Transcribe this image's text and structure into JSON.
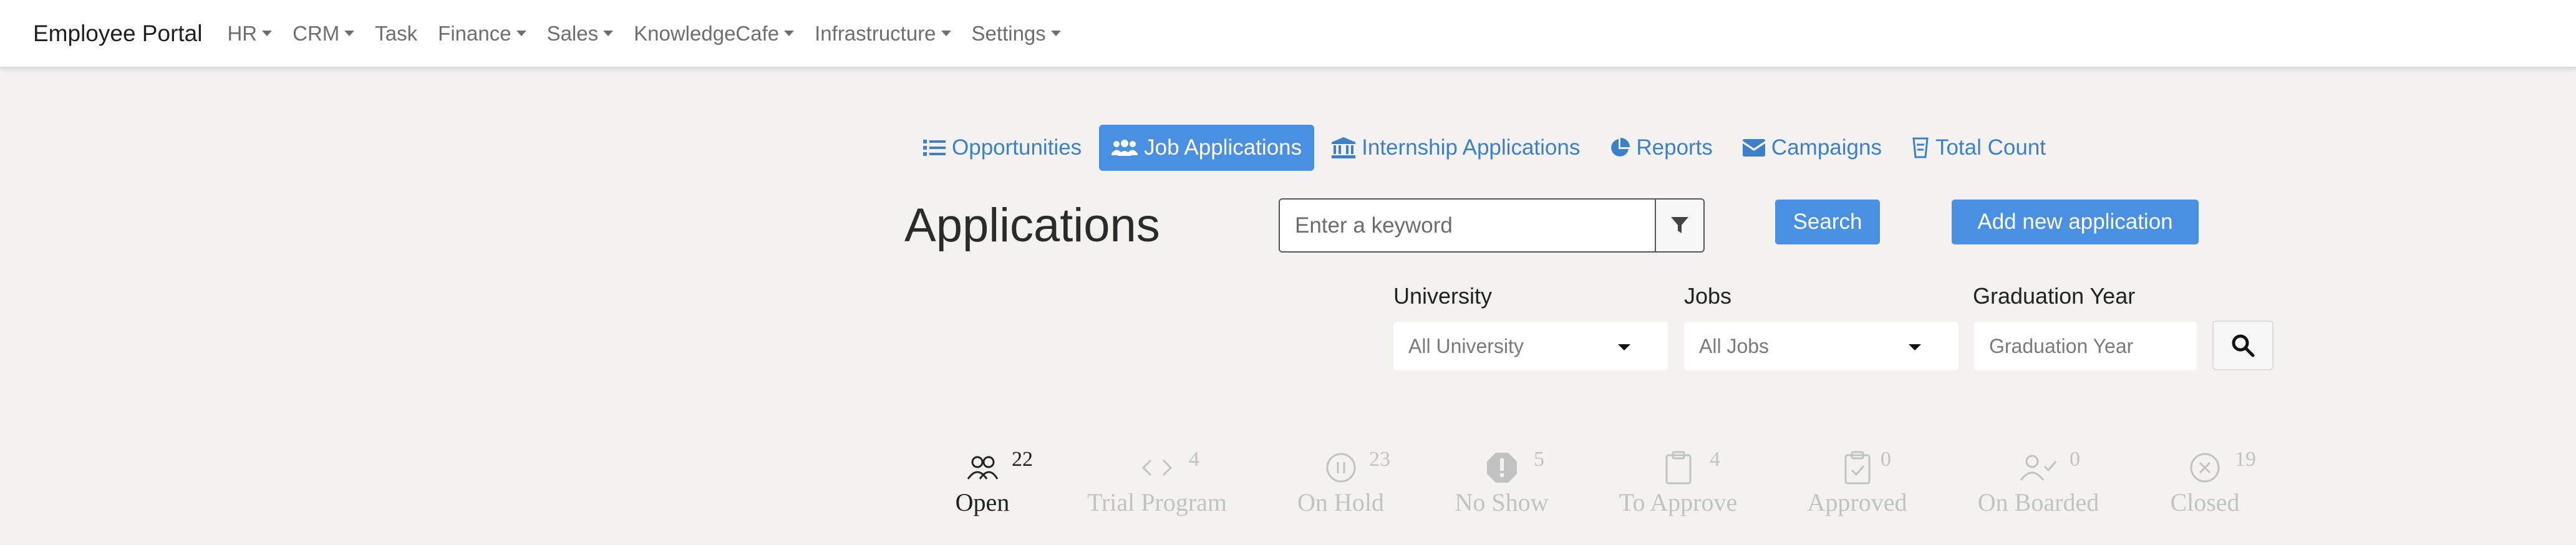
{
  "navbar": {
    "brand": "Employee Portal",
    "items": [
      {
        "label": "HR",
        "dropdown": true
      },
      {
        "label": "CRM",
        "dropdown": true
      },
      {
        "label": "Task",
        "dropdown": false
      },
      {
        "label": "Finance",
        "dropdown": true
      },
      {
        "label": "Sales",
        "dropdown": true
      },
      {
        "label": "KnowledgeCafe",
        "dropdown": true
      },
      {
        "label": "Infrastructure",
        "dropdown": true
      },
      {
        "label": "Settings",
        "dropdown": true
      }
    ]
  },
  "tabs": [
    {
      "label": "Opportunities",
      "icon": "list-icon",
      "active": false
    },
    {
      "label": "Job Applications",
      "icon": "users-icon",
      "active": true
    },
    {
      "label": "Internship Applications",
      "icon": "university-icon",
      "active": false
    },
    {
      "label": "Reports",
      "icon": "pie-chart-icon",
      "active": false
    },
    {
      "label": "Campaigns",
      "icon": "envelope-icon",
      "active": false
    },
    {
      "label": "Total Count",
      "icon": "badge-icon",
      "active": false
    }
  ],
  "page": {
    "title": "Applications",
    "search_placeholder": "Enter a keyword",
    "search_button": "Search",
    "add_button": "Add new application"
  },
  "filters": {
    "university": {
      "label": "University",
      "value": "All University"
    },
    "jobs": {
      "label": "Jobs",
      "value": "All Jobs"
    },
    "graduation_year": {
      "label": "Graduation Year",
      "placeholder": "Graduation Year"
    }
  },
  "statuses": [
    {
      "label": "Open",
      "count": "22",
      "icon": "users-outline-icon",
      "active": true
    },
    {
      "label": "Trial Program",
      "count": "4",
      "icon": "code-icon",
      "active": false
    },
    {
      "label": "On Hold",
      "count": "23",
      "icon": "pause-circle-icon",
      "active": false
    },
    {
      "label": "No Show",
      "count": "5",
      "icon": "alert-octagon-icon",
      "active": false
    },
    {
      "label": "To Approve",
      "count": "4",
      "icon": "clipboard-icon",
      "active": false
    },
    {
      "label": "Approved",
      "count": "0",
      "icon": "clipboard-check-icon",
      "active": false
    },
    {
      "label": "On Boarded",
      "count": "0",
      "icon": "user-check-icon",
      "active": false
    },
    {
      "label": "Closed",
      "count": "19",
      "icon": "x-circle-icon",
      "active": false
    }
  ],
  "colors": {
    "accent": "#4a90e2",
    "link": "#3d7fc9",
    "background": "#f3f2ee",
    "muted_status": "#c2c2c2"
  }
}
